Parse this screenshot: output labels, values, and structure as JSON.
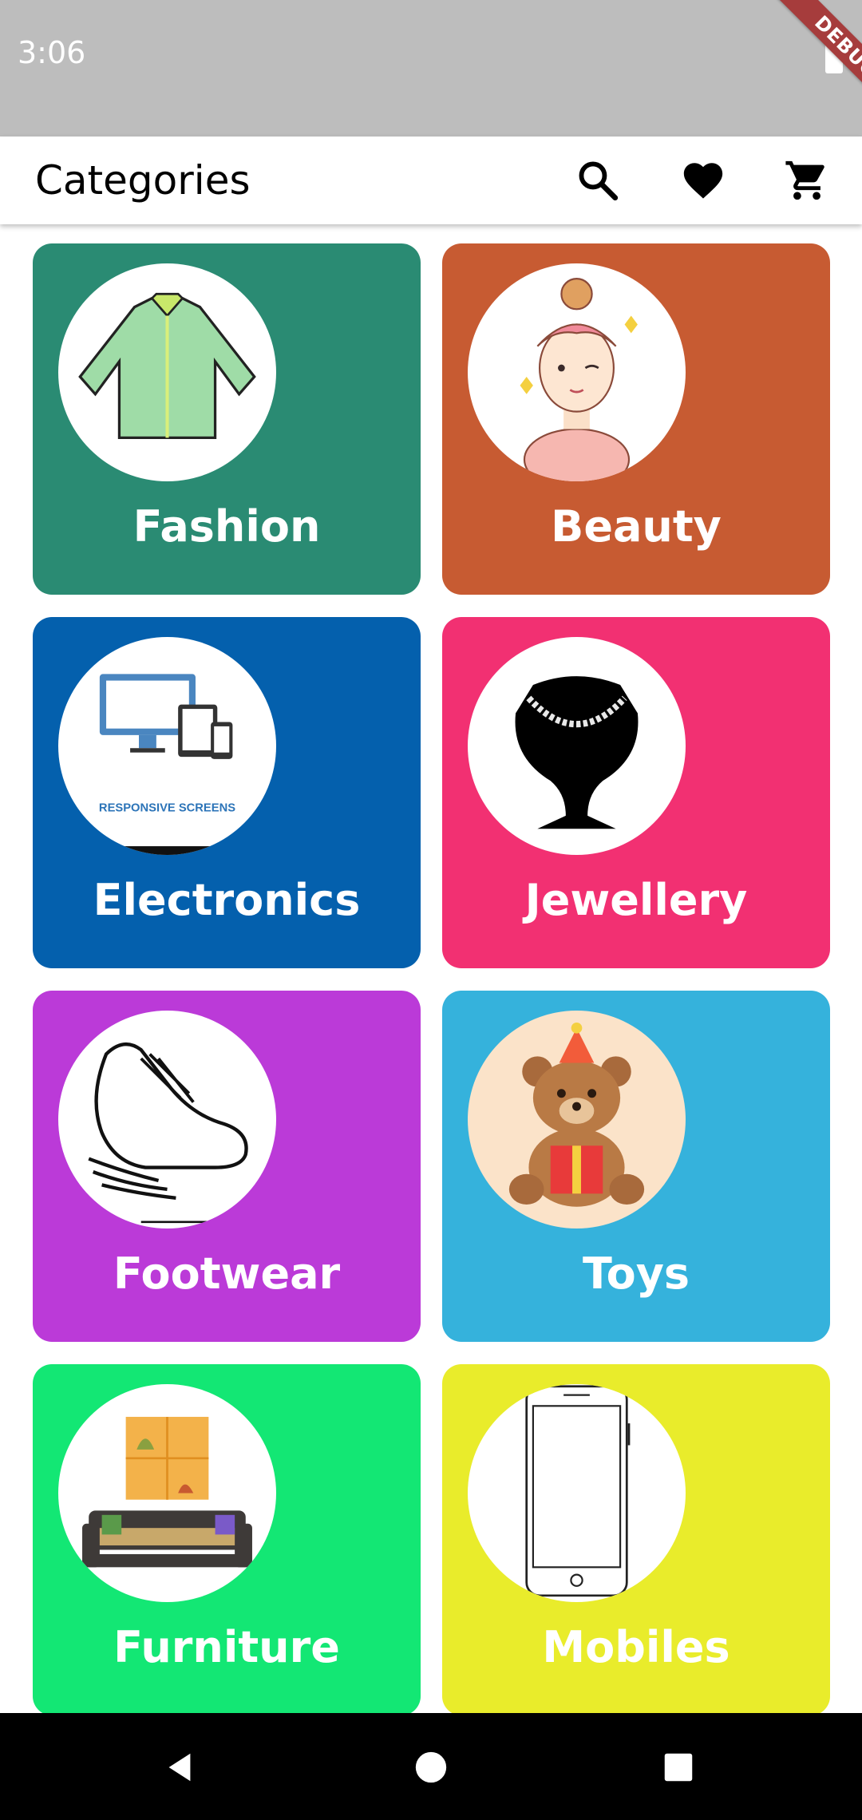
{
  "status_bar": {
    "time": "3:06"
  },
  "debug_banner": {
    "label": "DEBUG"
  },
  "app_bar": {
    "title": "Categories",
    "actions": [
      {
        "name": "search",
        "icon": "search-icon"
      },
      {
        "name": "favorites",
        "icon": "heart-icon"
      },
      {
        "name": "cart",
        "icon": "cart-icon"
      }
    ]
  },
  "categories": [
    {
      "label": "Fashion",
      "color": "#2a8b73",
      "image_icon": "shirt-icon"
    },
    {
      "label": "Beauty",
      "color": "#c75b32",
      "image_icon": "beauty-girl-icon"
    },
    {
      "label": "Electronics",
      "color": "#0460ad",
      "image_icon": "responsive-screens-icon",
      "image_caption": "RESPONSIVE SCREENS"
    },
    {
      "label": "Jewellery",
      "color": "#f23072",
      "image_icon": "necklace-bust-icon"
    },
    {
      "label": "Footwear",
      "color": "#bb3ad8",
      "image_icon": "shoe-icon"
    },
    {
      "label": "Toys",
      "color": "#35b2dc",
      "image_icon": "teddy-bear-icon"
    },
    {
      "label": "Furniture",
      "color": "#13e774",
      "image_icon": "sofa-icon"
    },
    {
      "label": "Mobiles",
      "color": "#e9ec2b",
      "image_icon": "smartphone-icon"
    }
  ],
  "nav_bar": {
    "buttons": [
      "back-icon",
      "home-icon",
      "recents-icon"
    ]
  }
}
